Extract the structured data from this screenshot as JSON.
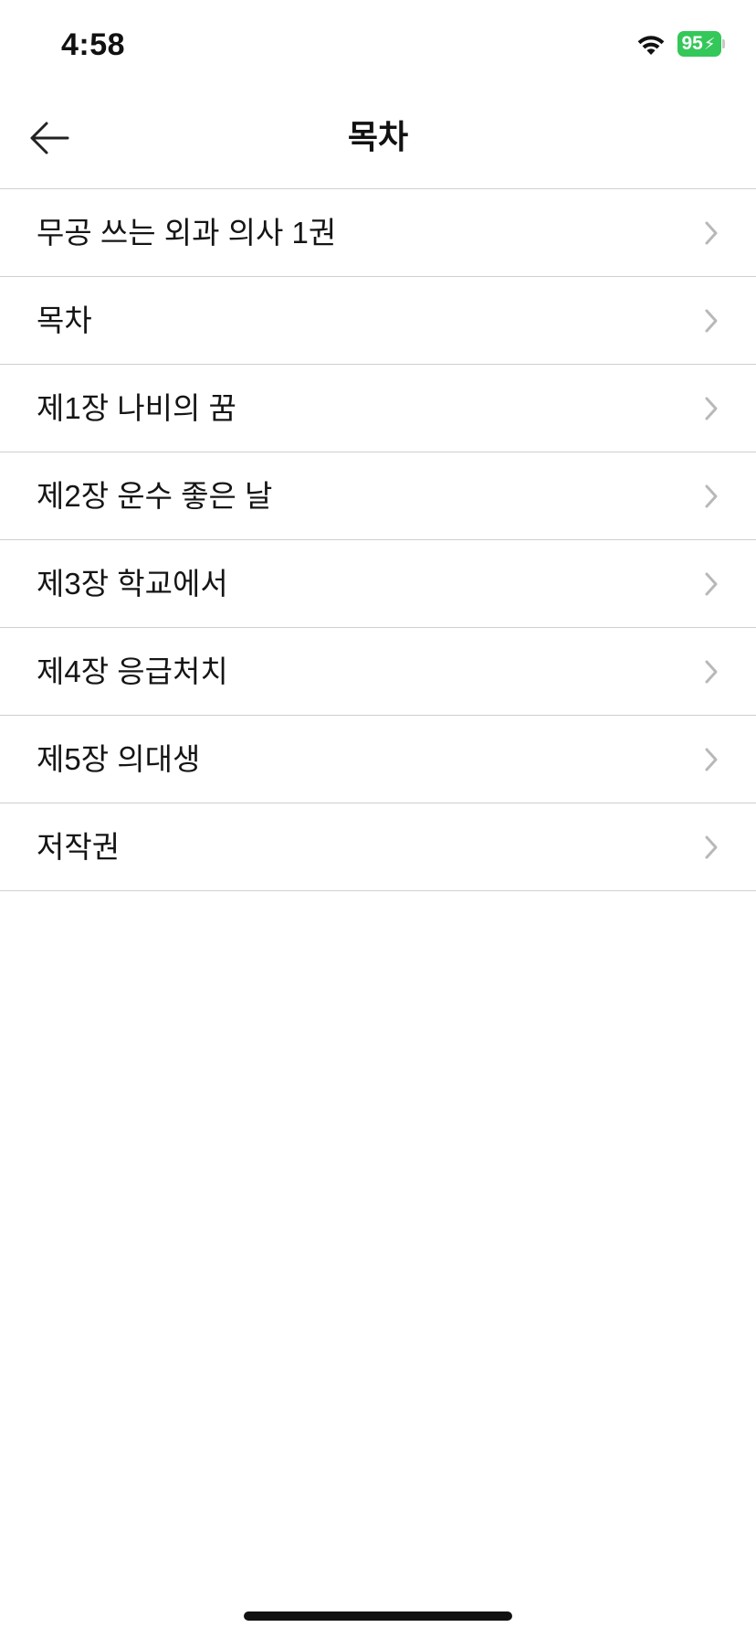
{
  "status_bar": {
    "time": "4:58",
    "battery_level": "95"
  },
  "nav": {
    "back_icon": "arrow-left-icon",
    "title": "목차"
  },
  "toc": {
    "chevron_icon": "chevron-right-icon",
    "items": [
      {
        "label": "무공 쓰는 외과 의사 1권"
      },
      {
        "label": "목차"
      },
      {
        "label": "제1장 나비의 꿈"
      },
      {
        "label": "제2장 운수 좋은 날"
      },
      {
        "label": "제3장 학교에서"
      },
      {
        "label": "제4장 응급처치"
      },
      {
        "label": "제5장 의대생"
      },
      {
        "label": "저작권"
      }
    ]
  },
  "colors": {
    "battery": "#34c759",
    "divider": "#cfcfcf",
    "chevron": "#b8b8b8"
  }
}
